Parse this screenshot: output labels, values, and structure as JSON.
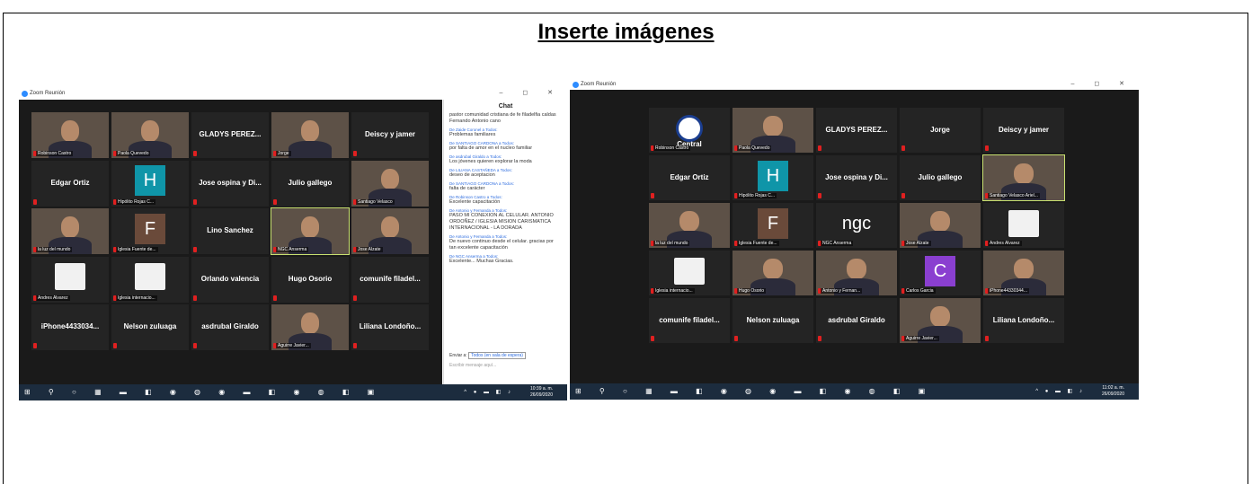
{
  "heading": "Inserte imágenes",
  "left": {
    "window_title": "Zoom Reunión",
    "tiles": [
      {
        "kind": "cam",
        "cap": "Robinson Castro"
      },
      {
        "kind": "cam",
        "cap": "Paola Quevedo"
      },
      {
        "kind": "name",
        "name": "GLADYS PEREZ..."
      },
      {
        "kind": "cam",
        "cap": "Jorge"
      },
      {
        "kind": "name",
        "name": "Deiscy y jamer"
      },
      {
        "kind": "name",
        "name": "Edgar Ortiz"
      },
      {
        "kind": "letter",
        "letter": "H",
        "color": "#0f95a8",
        "cap": "Hipólito Rojas C..."
      },
      {
        "kind": "name",
        "name": "Jose ospina y Di..."
      },
      {
        "kind": "name",
        "name": "Julio gallego"
      },
      {
        "kind": "cam",
        "cap": "Santiago Velasco"
      },
      {
        "kind": "cam",
        "cap": "la luz del mundo"
      },
      {
        "kind": "letter",
        "letter": "F",
        "color": "#6a4a3a",
        "cap": "Iglesia Fuente de..."
      },
      {
        "kind": "name",
        "name": "Lino Sanchez"
      },
      {
        "kind": "cam",
        "cap": "NGC Anserma",
        "hl": true
      },
      {
        "kind": "cam",
        "cap": "Jose Alzate"
      },
      {
        "kind": "logo",
        "cap": "Andres Alvarez"
      },
      {
        "kind": "logo",
        "cap": "Iglesia internacio..."
      },
      {
        "kind": "name",
        "name": "Orlando valencia"
      },
      {
        "kind": "name",
        "name": "Hugo Osorio"
      },
      {
        "kind": "name",
        "name": "comunife filadel..."
      },
      {
        "kind": "name",
        "name": "iPhone4433034..."
      },
      {
        "kind": "name",
        "name": "Nelson zuluaga"
      },
      {
        "kind": "name",
        "name": "asdrubal Giraldo"
      },
      {
        "kind": "cam",
        "cap": "Aguirre Javier..."
      },
      {
        "kind": "name",
        "name": "Liliana Londoño..."
      }
    ],
    "chat": {
      "title": "Chat",
      "messages": [
        {
          "from": "",
          "text": "pastor comunidad cristiana de fe filadelfia caldas Fernando Antonio cano"
        },
        {
          "from": "De Zaide Coronel a Todos:",
          "text": "Problemas familiares"
        },
        {
          "from": "De SANTIAGO CARDONA a Todos:",
          "text": "por falta de amor en el nucleo familiar"
        },
        {
          "from": "De asdrubal Giraldo a Todos:",
          "text": "Los jóvenes quieren explorar la moda"
        },
        {
          "from": "De LILIANA CASTAÑEDA a Todos:",
          "text": "deseo de aceptacion"
        },
        {
          "from": "De SANTIAGO CARDONA a Todos:",
          "text": "falta de carácter"
        },
        {
          "from": "De Robinson Castro a Todos:",
          "text": "Excelente capacitación"
        },
        {
          "from": "De Antonio y Fernanda a Todos:",
          "text": "PASO MI CONEXION AL CELULAR. ANTONIO ORDOÑEZ / IGLESIA MISION CARISMATICA INTERNACIONAL - LA DORADA"
        },
        {
          "from": "De Antonio y Fernanda a Todos:",
          "text": "De nuevo continuo desde el celular. gracias por tan excelente capacitación"
        },
        {
          "from": "De NGC Anserma a Todos:",
          "text": "Excelente... Muchas Gracias."
        }
      ],
      "send_label": "Enviar a:",
      "send_target": "Todos (en sala de espera)",
      "placeholder": "Escribir mensaje aquí..."
    },
    "clock": "10:39 a. m.",
    "date": "26/09/2020"
  },
  "right": {
    "window_title": "Zoom Reunión",
    "tiles": [
      {
        "kind": "logo",
        "name": "Central",
        "cap": "Robinson Castro"
      },
      {
        "kind": "cam",
        "cap": "Paola Quevedo"
      },
      {
        "kind": "name",
        "name": "GLADYS PEREZ..."
      },
      {
        "kind": "name",
        "name": "Jorge"
      },
      {
        "kind": "name",
        "name": "Deiscy y jamer"
      },
      {
        "kind": "name",
        "name": "Edgar Ortiz"
      },
      {
        "kind": "letter",
        "letter": "H",
        "color": "#0f95a8",
        "cap": "Hipólito Rojas C..."
      },
      {
        "kind": "name",
        "name": "Jose ospina y Di..."
      },
      {
        "kind": "name",
        "name": "Julio gallego"
      },
      {
        "kind": "cam",
        "cap": "Santiago Velasco Ariel...",
        "hl": true
      },
      {
        "kind": "cam",
        "cap": "la luz del mundo"
      },
      {
        "kind": "letter",
        "letter": "F",
        "color": "#6a4a3a",
        "cap": "Iglesia Fuente de..."
      },
      {
        "kind": "ngc",
        "cap": "NGC Anserma"
      },
      {
        "kind": "cam",
        "cap": "Jose Alzate"
      },
      {
        "kind": "logo",
        "cap": "Andres Alvarez"
      },
      {
        "kind": "logo",
        "cap": "Iglesia internacio..."
      },
      {
        "kind": "cam",
        "cap": "Hugo Osorio"
      },
      {
        "kind": "cam",
        "cap": "Antonio y Fernan..."
      },
      {
        "kind": "letter",
        "letter": "C",
        "color": "#8a3fd0",
        "cap": "Carlos Garcia"
      },
      {
        "kind": "cam",
        "cap": "iPhone44330344..."
      },
      {
        "kind": "name",
        "name": "comunife filadel..."
      },
      {
        "kind": "name",
        "name": "Nelson zuluaga"
      },
      {
        "kind": "name",
        "name": "asdrubal Giraldo"
      },
      {
        "kind": "cam",
        "cap": "Aguirre Javier..."
      },
      {
        "kind": "name",
        "name": "Liliana Londoño..."
      }
    ],
    "clock": "11:02 a. m.",
    "date": "26/09/2020"
  }
}
